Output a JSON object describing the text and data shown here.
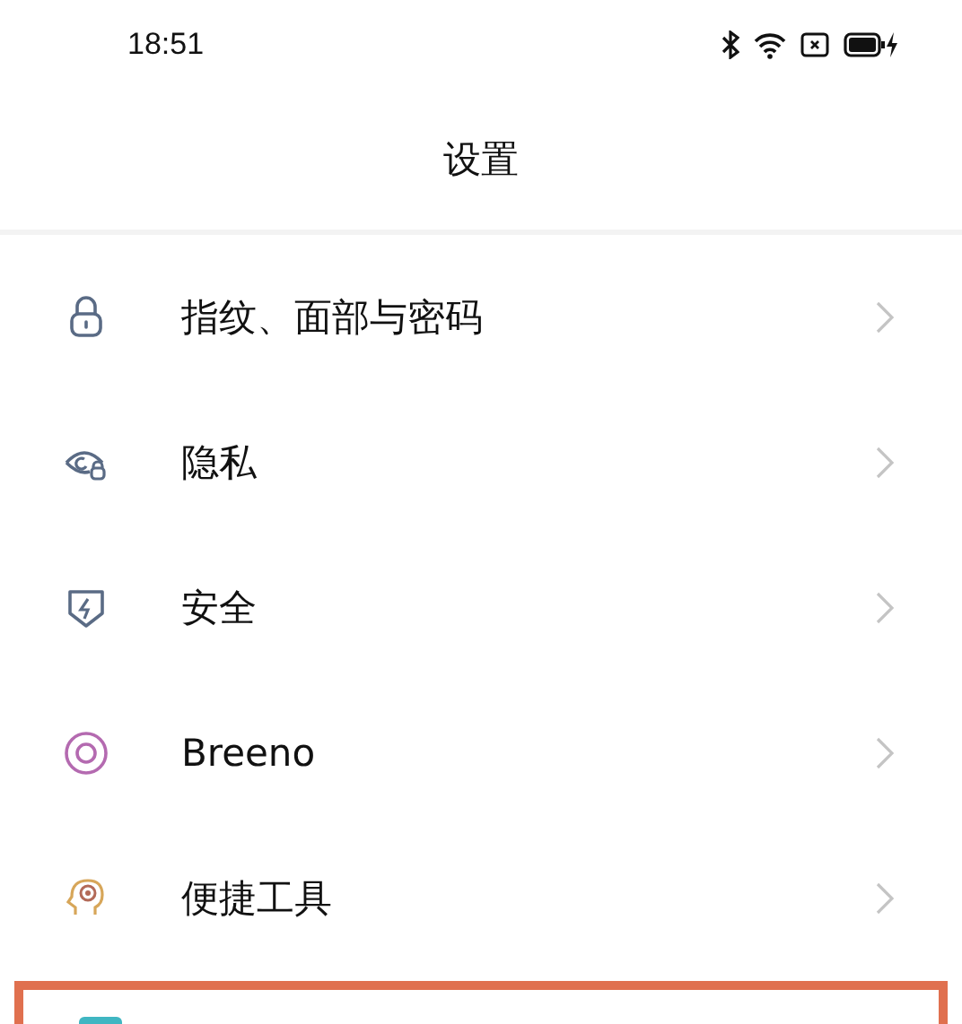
{
  "status_bar": {
    "time": "18:51"
  },
  "title": "设置",
  "items": [
    {
      "label": "指纹、面部与密码"
    },
    {
      "label": "隐私"
    },
    {
      "label": "安全"
    },
    {
      "label": "Breeno"
    },
    {
      "label": "便捷工具"
    }
  ],
  "partial_row": {
    "highlighted": true
  }
}
